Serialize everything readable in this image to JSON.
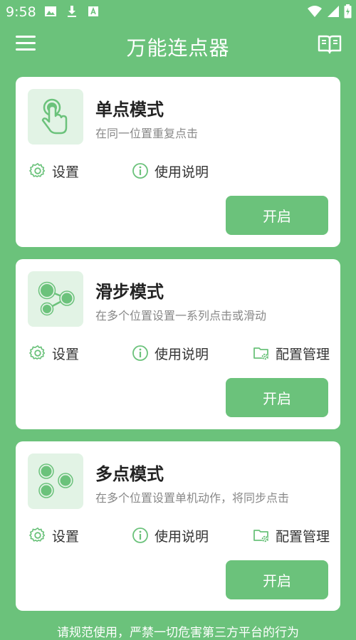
{
  "status_bar": {
    "time": "9:58",
    "icons": [
      "image-icon",
      "download-icon",
      "app-a-icon",
      "wifi-icon",
      "signal-icon",
      "battery-icon"
    ]
  },
  "app_bar": {
    "title": "万能连点器",
    "left_icon": "menu-icon",
    "right_icon": "book-icon"
  },
  "colors": {
    "accent": "#6BC27B",
    "icon_bg": "#E2F3E5",
    "card_bg": "#FFFFFF"
  },
  "cards": [
    {
      "title": "单点模式",
      "description": "在同一位置重复点击",
      "icon": "tap-hand-icon",
      "actions": [
        {
          "label": "设置",
          "icon": "gear-icon"
        },
        {
          "label": "使用说明",
          "icon": "info-icon"
        }
      ],
      "button_label": "开启"
    },
    {
      "title": "滑步模式",
      "description": "在多个位置设置一系列点击或滑动",
      "icon": "swipe-nodes-icon",
      "actions": [
        {
          "label": "设置",
          "icon": "gear-icon"
        },
        {
          "label": "使用说明",
          "icon": "info-icon"
        },
        {
          "label": "配置管理",
          "icon": "folder-gear-icon"
        }
      ],
      "button_label": "开启"
    },
    {
      "title": "多点模式",
      "description": "在多个位置设置单机动作，将同步点击",
      "icon": "multi-dots-icon",
      "actions": [
        {
          "label": "设置",
          "icon": "gear-icon"
        },
        {
          "label": "使用说明",
          "icon": "info-icon"
        },
        {
          "label": "配置管理",
          "icon": "folder-gear-icon"
        }
      ],
      "button_label": "开启"
    }
  ],
  "footer": {
    "text": "请规范使用，严禁一切危害第三方平台的行为"
  }
}
